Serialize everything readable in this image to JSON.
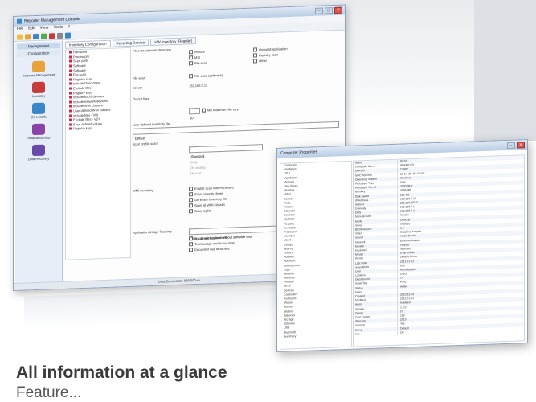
{
  "headline": "All information at a glance",
  "subline": "Feature...",
  "main_window": {
    "title": "Reporter Management Console",
    "menu": [
      "File",
      "Edit",
      "View",
      "Tools",
      "?"
    ],
    "left_pane": {
      "header": "Management",
      "section": "Configuration",
      "nav": [
        {
          "label": "Software Management",
          "color": "#e8a33b"
        },
        {
          "label": "Inventory",
          "color": "#c63b3b"
        },
        {
          "label": "OS Installs",
          "color": "#3a86c8"
        },
        {
          "label": "Protocol Backup",
          "color": "#8a44a8"
        },
        {
          "label": "Data Recovery",
          "color": "#6a4aa8"
        }
      ]
    },
    "tabs": [
      "Inventory Configuration",
      "Reporting Service",
      "HW inventory (Regular)"
    ],
    "tree": [
      "Hardware",
      "Processors",
      "Scan path",
      "Software",
      "Software",
      "File scan",
      "Registry scan",
      "Include Directories",
      "Exclude files",
      "Registry keys",
      "Include BIOS devices",
      "Include network devices",
      "Include WMI classes",
      "User defined WMI classes",
      "Include files - VDI",
      "Exclude files - VDI",
      "Scan defined values",
      "Registry keys"
    ],
    "form": {
      "scan_label": "Files for software detection",
      "checkboxes": [
        "Include",
        "MSI",
        "File scan",
        "Uninstall application",
        "Registry scan",
        "Other"
      ],
      "file_scan_label": "File scan",
      "file_scan_check": "File scan (software)",
      "server_label": "Server",
      "server_value": "192.168.0.12",
      "output_label": "Output files",
      "output_check": "MB maximum file size",
      "output_value": "50",
      "user_defined_label": "User defined inventory file",
      "user_defined_value": "Default",
      "scan_profile_label": "Scan profile scan",
      "profile_value": "Standard",
      "options": [
        "Automatic",
        "Daily",
        "On startup",
        "Manual"
      ],
      "wmi_label": "WMI Inventory",
      "wmi_items": [
        "Enable scan with Hardware",
        "Scan network drives",
        "Generate inventory file",
        "Scan all WMI classes",
        "Scan logfile"
      ],
      "app_usage_label": "Application Usage Tracking",
      "app_usage_value": "Track all applications without software filter",
      "app_usage_items": [
        "Track web applications",
        "Track usage and active time",
        "Document use of all files"
      ]
    },
    "status": "Data Connection: 000-000-xx"
  },
  "prop_window": {
    "title": "Computer Properties",
    "tree": [
      "Computer",
      "Hardware",
      "CPU",
      "Mainboard",
      "Memory",
      "Disk drives",
      "Network",
      "Video",
      "Sound",
      "Ports",
      "Printers",
      "Software",
      "Services",
      "Updates",
      "Registry",
      "Inventory",
      "Processes",
      "Licenses",
      "Users",
      "Groups",
      "Shares",
      "Drivers",
      "Hotfixes",
      "Autostart",
      "Environment",
      "Logs",
      "Security",
      "Antivirus",
      "Firewall",
      "BIOS",
      "Devices",
      "Controllers",
      "Keyboard",
      "Mouse",
      "Monitor",
      "Modem",
      "Batteries",
      "Storage",
      "Volumes",
      "USB",
      "Bluetooth",
      "Summary"
    ],
    "rows": [
      [
        "Name",
        "PC01"
      ],
      [
        "Computer Name",
        "WS000123"
      ],
      [
        "Domain",
        "CORP"
      ],
      [
        "MAC Address",
        "00-1A-2B-3C-4D-5E"
      ],
      [
        "Operating System",
        "Windows"
      ],
      [
        "Processor Type",
        "Intel"
      ],
      [
        "Processor Speed",
        "3000 MHz"
      ],
      [
        "Memory",
        "4096 MB"
      ],
      [
        "Disk Space",
        "500 GB"
      ],
      [
        "IP Address",
        "192.168.0.23"
      ],
      [
        "Subnet",
        "255.255.255.0"
      ],
      [
        "Gateway",
        "192.168.0.1"
      ],
      [
        "DNS",
        "192.168.0.2"
      ],
      [
        "Manufacturer",
        "Vendor"
      ],
      [
        "Model",
        "Desktop"
      ],
      [
        "Serial",
        "SN0001"
      ],
      [
        "BIOS Version",
        "1.0"
      ],
      [
        "Video",
        "Graphics Adapter"
      ],
      [
        "Sound",
        "Audio Device"
      ],
      [
        "Network",
        "Ethernet Adapter"
      ],
      [
        "Monitor",
        "Display"
      ],
      [
        "Keyboard",
        "Standard"
      ],
      [
        "Mouse",
        "USB Mouse"
      ],
      [
        "Printer",
        "Default Printer"
      ],
      [
        "Last Scan",
        "2011-01-01"
      ],
      [
        "Scan Mode",
        "Full"
      ],
      [
        "User",
        "Administrator"
      ],
      [
        "Location",
        "Office"
      ],
      [
        "Department",
        "IT"
      ],
      [
        "Asset Tag",
        "A-001"
      ],
      [
        "Status",
        "Active"
      ],
      [
        "Notes",
        ""
      ],
      [
        "Created",
        "2010-12-01"
      ],
      [
        "Modified",
        "2011-01-01"
      ],
      [
        "Agent",
        "Installed"
      ],
      [
        "Version",
        "1.0.0"
      ],
      [
        "Owner",
        "IT"
      ],
      [
        "Cost Center",
        "100"
      ],
      [
        "Warranty",
        "2013"
      ],
      [
        "Support",
        "Yes"
      ],
      [
        "Group",
        "Default"
      ],
      [
        "Info",
        "OK"
      ]
    ]
  },
  "colors": {
    "accent": "#3a86c8"
  }
}
